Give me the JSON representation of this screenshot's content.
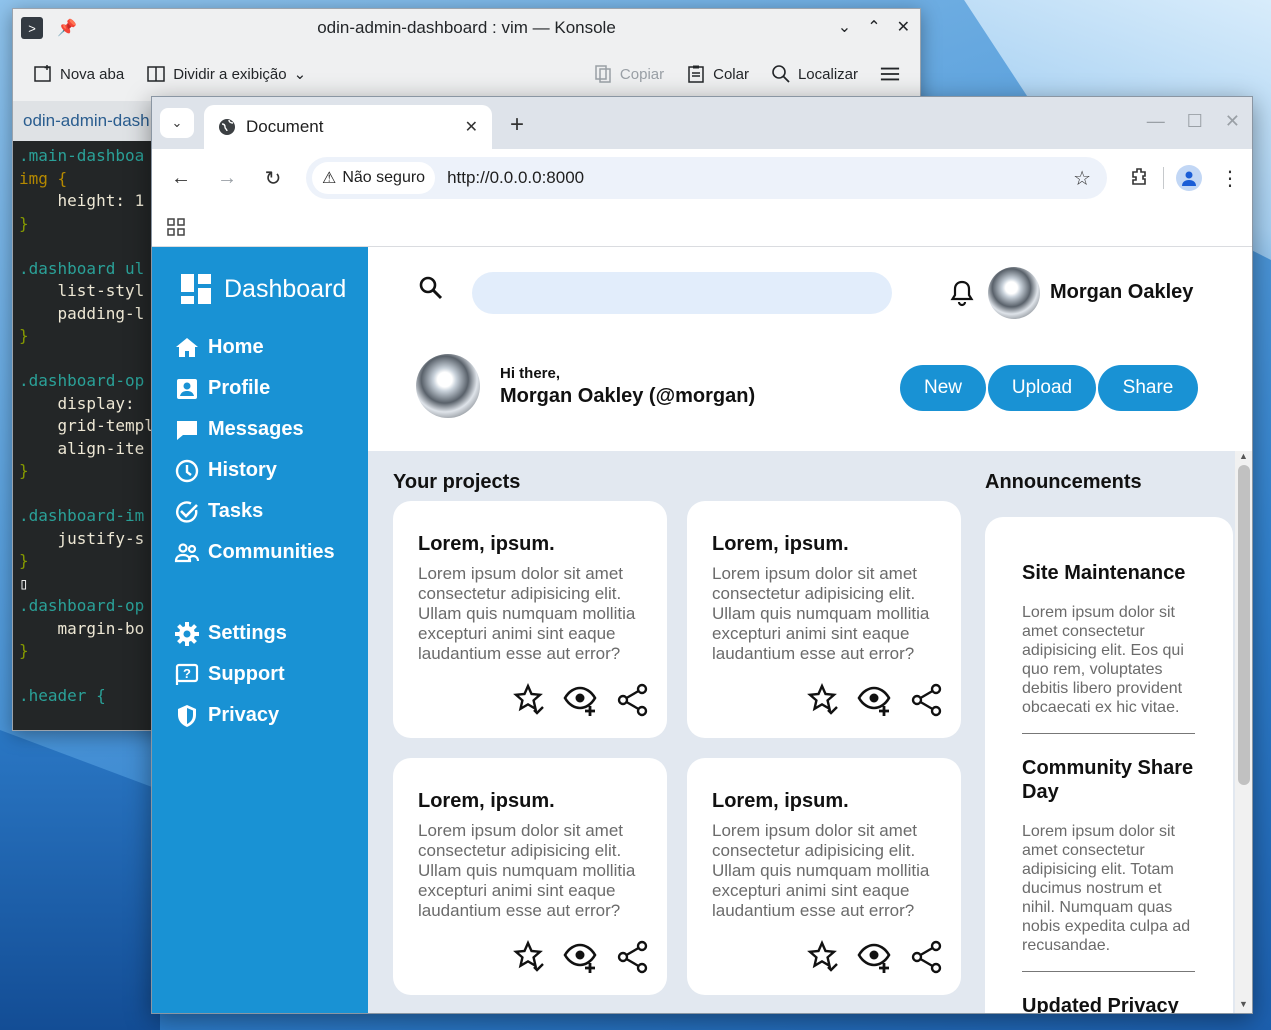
{
  "konsole": {
    "title": "odin-admin-dashboard : vim — Konsole",
    "toolbar": {
      "new_tab": "Nova aba",
      "split": "Dividir a exibição",
      "copy": "Copiar",
      "paste": "Colar",
      "find": "Localizar"
    },
    "tab_label": "odin-admin-dash",
    "code_lines": [
      ".main-dashboa",
      "img {",
      "    height: 1",
      "}",
      "",
      ".dashboard ul",
      "    list-styl",
      "    padding-l",
      "}",
      "",
      ".dashboard-op",
      "    display: ",
      "    grid-templ",
      "    align-ite",
      "}",
      "",
      ".dashboard-im",
      "    justify-s",
      "}",
      "▯",
      ".dashboard-op",
      "    margin-bo",
      "}",
      "",
      ".header {"
    ]
  },
  "browser": {
    "tab_title": "Document",
    "security_label": "Não seguro",
    "url": "http://0.0.0.0:8000"
  },
  "sidebar": {
    "brand": "Dashboard",
    "items": [
      {
        "label": "Home",
        "icon": "home-icon"
      },
      {
        "label": "Profile",
        "icon": "profile-icon"
      },
      {
        "label": "Messages",
        "icon": "messages-icon"
      },
      {
        "label": "History",
        "icon": "history-icon"
      },
      {
        "label": "Tasks",
        "icon": "tasks-icon"
      },
      {
        "label": "Communities",
        "icon": "communities-icon"
      }
    ],
    "bottom_items": [
      {
        "label": "Settings",
        "icon": "settings-icon"
      },
      {
        "label": "Support",
        "icon": "support-icon"
      },
      {
        "label": "Privacy",
        "icon": "privacy-icon"
      }
    ]
  },
  "header": {
    "search_placeholder": "",
    "username": "Morgan Oakley",
    "greeting": "Hi there,",
    "handle": "Morgan Oakley (@morgan)",
    "actions": [
      "New",
      "Upload",
      "Share"
    ]
  },
  "projects": {
    "title": "Your projects",
    "cards": [
      {
        "title": "Lorem, ipsum.",
        "body": "Lorem ipsum dolor sit amet consectetur adipisicing elit. Ullam quis numquam mollitia excepturi animi sint eaque laudantium esse aut error?"
      },
      {
        "title": "Lorem, ipsum.",
        "body": "Lorem ipsum dolor sit amet consectetur adipisicing elit. Ullam quis numquam mollitia excepturi animi sint eaque laudantium esse aut error?"
      },
      {
        "title": "Lorem, ipsum.",
        "body": "Lorem ipsum dolor sit amet consectetur adipisicing elit. Ullam quis numquam mollitia excepturi animi sint eaque laudantium esse aut error?"
      },
      {
        "title": "Lorem, ipsum.",
        "body": "Lorem ipsum dolor sit amet consectetur adipisicing elit. Ullam quis numquam mollitia excepturi animi sint eaque laudantium esse aut error?"
      }
    ]
  },
  "announcements": {
    "title": "Announcements",
    "items": [
      {
        "title": "Site Maintenance",
        "body": "Lorem ipsum dolor sit amet consectetur adipisicing elit. Eos qui quo rem, voluptates debitis libero provident obcaecati ex hic vitae."
      },
      {
        "title": "Community Share Day",
        "body": "Lorem ipsum dolor sit amet consectetur adipisicing elit. Totam ducimus nostrum et nihil. Numquam quas nobis expedita culpa ad recusandae."
      },
      {
        "title": "Updated Privacy",
        "body": ""
      }
    ]
  },
  "colors": {
    "accent": "#1992d4",
    "page_bg": "#e2e8f0",
    "muted_text": "#6b6b6b"
  }
}
